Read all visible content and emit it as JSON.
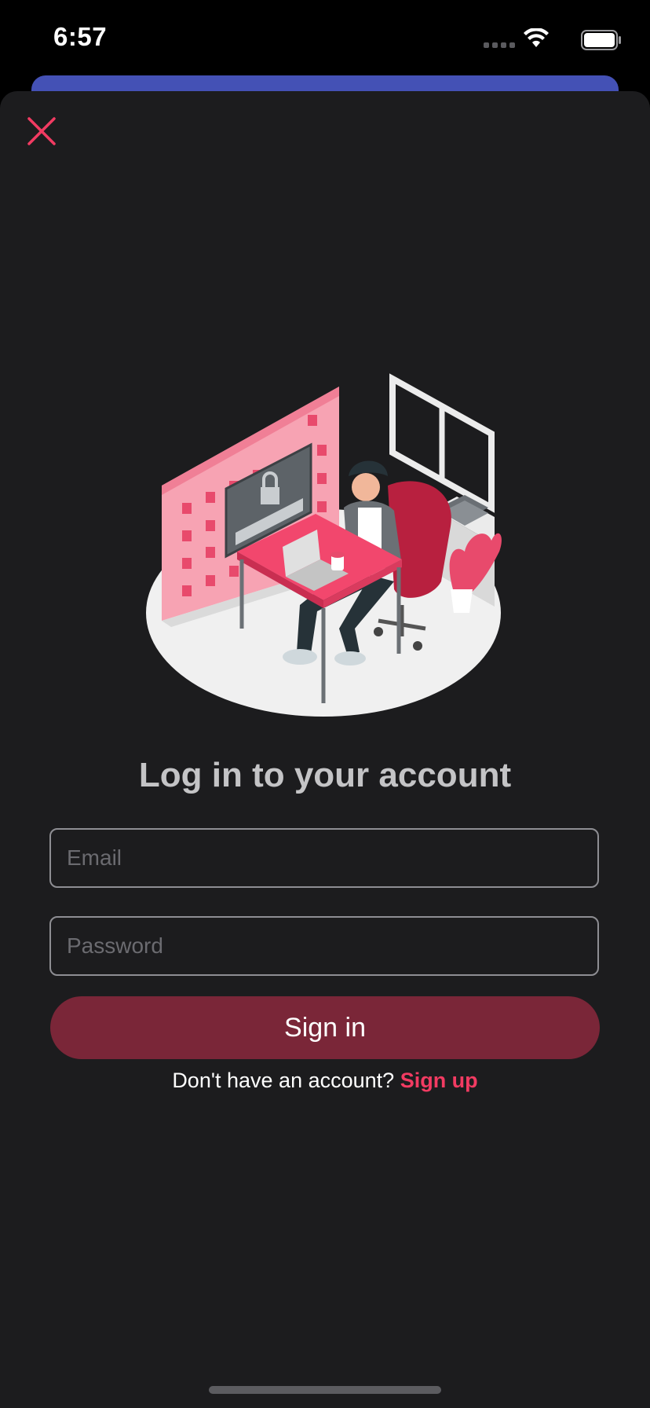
{
  "status_bar": {
    "time": "6:57",
    "icons": [
      "signal-dots-icon",
      "wifi-icon",
      "battery-icon"
    ]
  },
  "colors": {
    "accent": "#f23b62",
    "button_bg": "#7a2638",
    "sheet_bg": "#1c1c1e",
    "behind_card": "#4451b5"
  },
  "header": {
    "close_icon": "close-icon"
  },
  "login": {
    "title": "Log in to your account",
    "email_placeholder": "Email",
    "email_value": "",
    "password_placeholder": "Password",
    "password_value": "",
    "sign_in_label": "Sign in",
    "no_account_text": "Don't have an account?",
    "sign_up_label": "Sign up"
  }
}
